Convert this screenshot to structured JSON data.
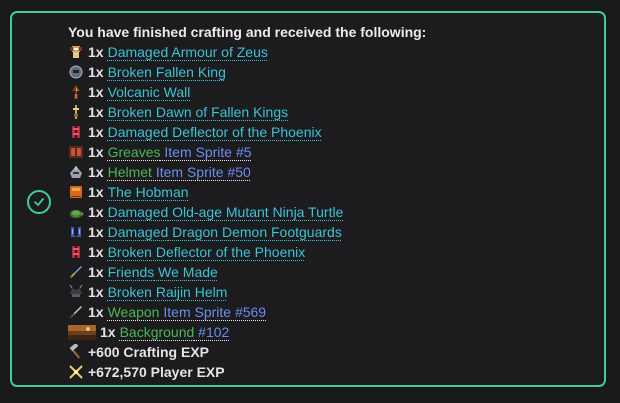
{
  "title": "You have finished crafting and received the following:",
  "colors": {
    "border": "#3fcf96",
    "check": "#3fcf96",
    "item_cyan": "#39c3d8",
    "item_green": "#4ab852",
    "item_blue": "#6e8cf2"
  },
  "items": [
    {
      "qty": "1x",
      "prefix": "Damaged",
      "rest": " Armour of Zeus",
      "icon": "armour-icon"
    },
    {
      "qty": "1x",
      "prefix": "Broken",
      "rest": " Fallen King",
      "icon": "helm-icon"
    },
    {
      "qty": "1x",
      "prefix": "Volcanic",
      "rest": " Wall",
      "icon": "volcanic-wall-icon"
    },
    {
      "qty": "1x",
      "prefix": "Broken",
      "rest": " Dawn of Fallen Kings",
      "icon": "dawn-icon"
    },
    {
      "qty": "1x",
      "prefix": "Damaged",
      "rest": " Deflector of the Phoenix",
      "icon": "deflector-icon"
    },
    {
      "qty": "1x",
      "prefix": "Greaves",
      "rest": " Item Sprite #5",
      "icon": "greaves-icon"
    },
    {
      "qty": "1x",
      "prefix": "Helmet",
      "rest": " Item Sprite #50",
      "icon": "helmet-icon"
    },
    {
      "qty": "1x",
      "prefix": "The",
      "rest": " Hobman",
      "icon": "book-icon"
    },
    {
      "qty": "1x",
      "prefix": "Damaged",
      "rest": " Old-age Mutant Ninja Turtle",
      "icon": "turtle-icon"
    },
    {
      "qty": "1x",
      "prefix": "Damaged",
      "rest": " Dragon Demon Footguards",
      "icon": "footguards-icon"
    },
    {
      "qty": "1x",
      "prefix": "Broken",
      "rest": " Deflector of the Phoenix",
      "icon": "deflector-icon"
    },
    {
      "qty": "1x",
      "prefix": "Friends",
      "rest": " We Made",
      "icon": "sword-icon"
    },
    {
      "qty": "1x",
      "prefix": "Broken",
      "rest": " Raijin Helm",
      "icon": "raijin-helm-icon"
    },
    {
      "qty": "1x",
      "prefix": "Weapon",
      "rest": " Item Sprite #569",
      "icon": "weapon-sword-icon"
    },
    {
      "qty": "1x",
      "prefix": "Background",
      "rest": " #102",
      "icon": "background-thumbnail-icon"
    }
  ],
  "crafting_exp": "+600 Crafting EXP",
  "player_exp": "+672,570 Player EXP"
}
